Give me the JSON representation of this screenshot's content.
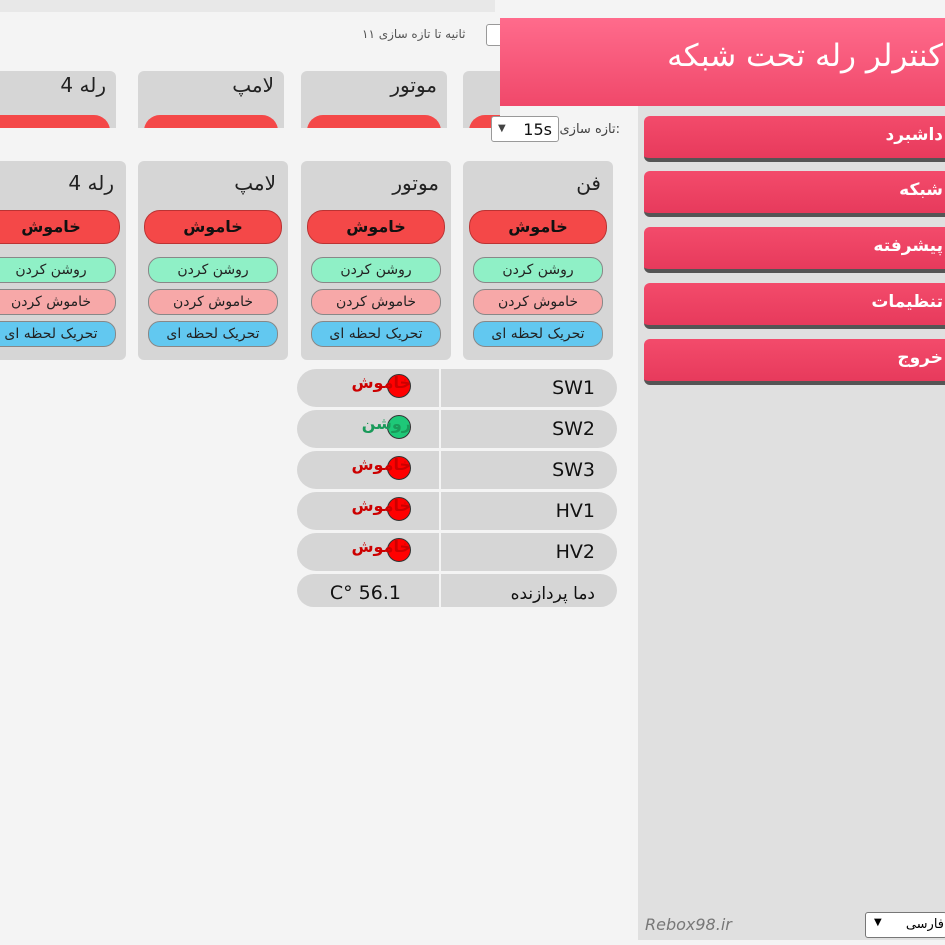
{
  "header": {
    "title": "کنترلر رله تحت شبکه"
  },
  "sidebar": {
    "items": [
      {
        "label": "داشبرد"
      },
      {
        "label": "شبکه"
      },
      {
        "label": "پیشرفته"
      },
      {
        "label": "تنظیمات"
      },
      {
        "label": "خروج"
      }
    ],
    "footer": "Rebox98.ir",
    "language": "فارسی"
  },
  "refresh": {
    "label": "تازه سازی:",
    "value": "15s"
  },
  "ghost": {
    "refresh_label": "۱۱ ثانیه تا تازه سازی"
  },
  "cards": [
    {
      "title": "فن",
      "state": "خاموش",
      "on": "روشن کردن",
      "off": "خاموش کردن",
      "pulse": "تحریک لحظه ای"
    },
    {
      "title": "موتور",
      "state": "خاموش",
      "on": "روشن کردن",
      "off": "خاموش کردن",
      "pulse": "تحریک لحظه ای"
    },
    {
      "title": "لامپ",
      "state": "خاموش",
      "on": "روشن کردن",
      "off": "خاموش کردن",
      "pulse": "تحریک لحظه ای"
    },
    {
      "title": "رله 4",
      "state": "خاموش",
      "on": "روشن کردن",
      "off": "خاموش کردن",
      "pulse": "تحریک لحظه ای"
    }
  ],
  "status": [
    {
      "name": "SW1",
      "value": "خاموش",
      "color": "#cc0000",
      "led": "red"
    },
    {
      "name": "SW2",
      "value": "روشن",
      "color": "#1a9a5a",
      "led": "green"
    },
    {
      "name": "SW3",
      "value": "خاموش",
      "color": "#cc0000",
      "led": "red"
    },
    {
      "name": "HV1",
      "value": "خاموش",
      "color": "#cc0000",
      "led": "red"
    },
    {
      "name": "HV2",
      "value": "خاموش",
      "color": "#cc0000",
      "led": "red"
    }
  ],
  "temperature": {
    "name": "دما پردازنده",
    "value": "C° 56.1"
  }
}
